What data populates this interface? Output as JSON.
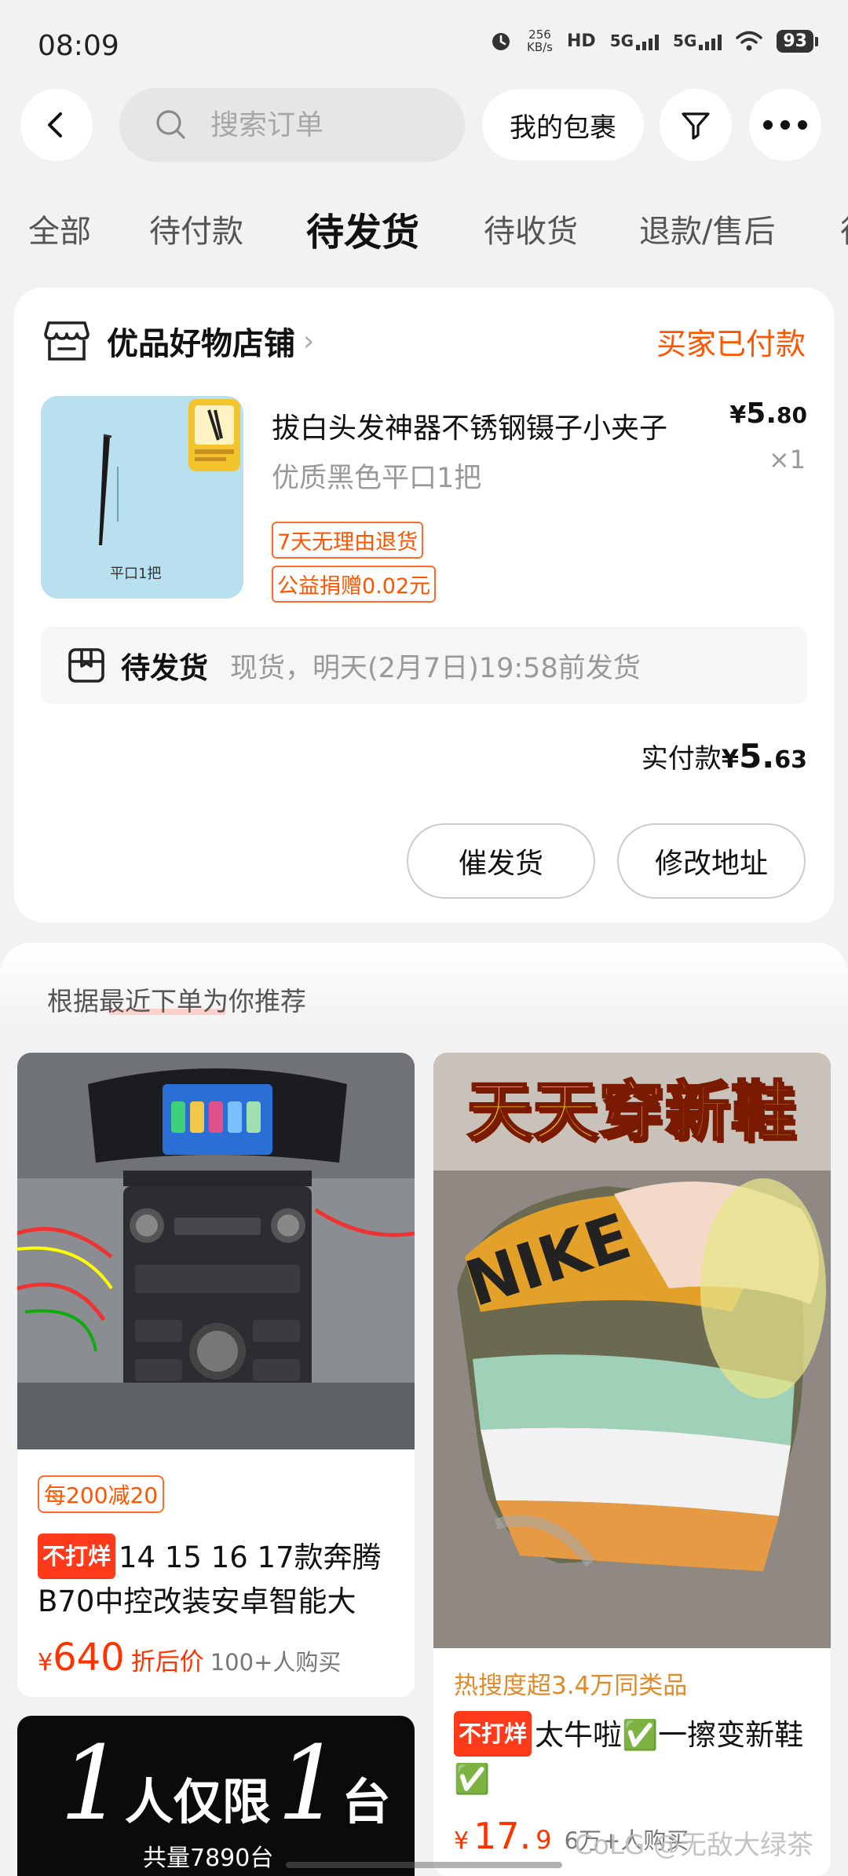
{
  "status_bar": {
    "time": "08:09",
    "net_speed_value": "256",
    "net_speed_unit": "KB/s",
    "hd_label": "HD",
    "signal1": "5G",
    "signal2": "5G",
    "battery": "93",
    "icons": [
      "alarm-icon",
      "hd-icon",
      "signal-icon",
      "wifi-icon",
      "battery-icon"
    ]
  },
  "top_bar": {
    "search_placeholder": "搜索订单",
    "my_packages": "我的包裹",
    "icons": [
      "back-icon",
      "search-icon",
      "filter-icon",
      "more-icon"
    ]
  },
  "tabs": [
    {
      "label": "全部",
      "active": false
    },
    {
      "label": "待付款",
      "active": false
    },
    {
      "label": "待发货",
      "active": true
    },
    {
      "label": "待收货",
      "active": false
    },
    {
      "label": "退款/售后",
      "active": false
    }
  ],
  "order": {
    "shop_name": "优品好物店铺",
    "status": "买家已付款",
    "product_title": "拔白头发神器不锈钢镊子小夹子",
    "product_spec": "优质黑色平口1把",
    "image_caption": "平口1把",
    "price_symbol": "¥",
    "price_int": "5.",
    "price_dec": "80",
    "quantity": "×1",
    "tags": [
      "7天无理由退货",
      "公益捐赠0.02元"
    ],
    "ship_status": "待发货",
    "ship_desc": "现货，明天(2月7日)19:58前发货",
    "paid_label": "实付款",
    "paid_symbol": "¥",
    "paid_int": "5.",
    "paid_dec": "63",
    "buttons": {
      "urge": "催发货",
      "address": "修改地址"
    }
  },
  "recommend": {
    "title": "根据最近下单为你推荐",
    "item1": {
      "image_label": "car stereo head unit",
      "promo": "每200减20",
      "badge": "不打烊",
      "name": "14 15 16 17款奔腾B70中控改装安卓智能大",
      "price_symbol": "¥",
      "price": "640",
      "price_note": "折后价",
      "sales": "100+人购买"
    },
    "item2": {
      "banner": "天天穿新鞋",
      "hot": "热搜度超3.4万同类品",
      "badge": "不打烊",
      "name": "太牛啦✅一擦变新鞋✅",
      "price_symbol": "¥",
      "price_int": "17.",
      "price_dec": "9",
      "sales": "6万+人购买",
      "watermark": "CoLG @无敌大绿茶"
    },
    "item3": {
      "banner_num": "1",
      "banner_text1": "人仅限",
      "banner_text2": "台",
      "banner_sub": "共量7890台"
    }
  },
  "colors": {
    "accent": "#ff5500",
    "price_red": "#ff3300",
    "background": "#f2f2f2"
  }
}
